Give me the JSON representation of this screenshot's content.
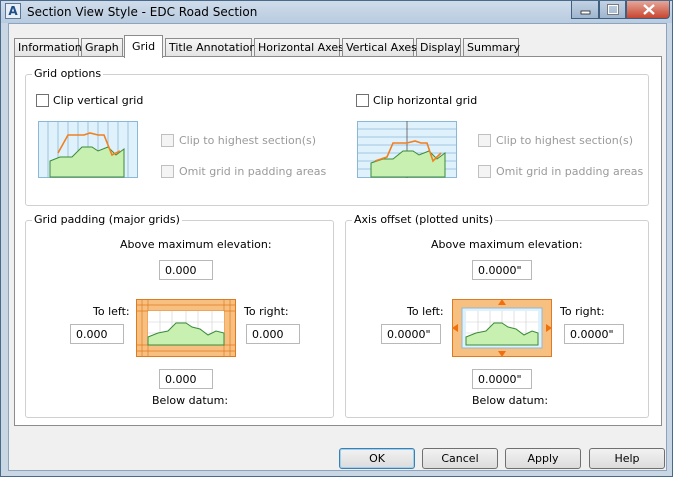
{
  "window": {
    "title": "Section View Style - EDC Road Section",
    "app_icon": "A"
  },
  "tabs": [
    {
      "label": "Information"
    },
    {
      "label": "Graph"
    },
    {
      "label": "Grid"
    },
    {
      "label": "Title Annotation"
    },
    {
      "label": "Horizontal Axes"
    },
    {
      "label": "Vertical Axes"
    },
    {
      "label": "Display"
    },
    {
      "label": "Summary"
    }
  ],
  "active_tab": "Grid",
  "grid_options": {
    "label": "Grid options",
    "clip_vertical": {
      "label": "Clip vertical grid",
      "checked": false
    },
    "clip_horizontal": {
      "label": "Clip horizontal grid",
      "checked": false
    },
    "left_sub": {
      "clip_highest": "Clip to highest section(s)",
      "omit_padding": "Omit grid in padding areas"
    },
    "right_sub": {
      "clip_highest": "Clip to highest section(s)",
      "omit_padding": "Omit grid in padding areas"
    }
  },
  "grid_padding": {
    "label": "Grid padding (major grids)",
    "above_label": "Above maximum elevation:",
    "above_value": "0.000",
    "left_label": "To left:",
    "left_value": "0.000",
    "right_label": "To right:",
    "right_value": "0.000",
    "below_label": "Below datum:",
    "below_value": "0.000"
  },
  "axis_offset": {
    "label": "Axis offset (plotted units)",
    "above_label": "Above maximum elevation:",
    "above_value": "0.0000\"",
    "left_label": "To left:",
    "left_value": "0.0000\"",
    "right_label": "To right:",
    "right_value": "0.0000\"",
    "below_label": "Below datum:",
    "below_value": "0.0000\""
  },
  "buttons": {
    "ok": "OK",
    "cancel": "Cancel",
    "apply": "Apply",
    "help": "Help"
  },
  "colors": {
    "grid_fill": "#cce8f8",
    "ground_fill": "#c8f0b0",
    "profile_line": "#f08020",
    "padding_fill": "#f8c080"
  }
}
